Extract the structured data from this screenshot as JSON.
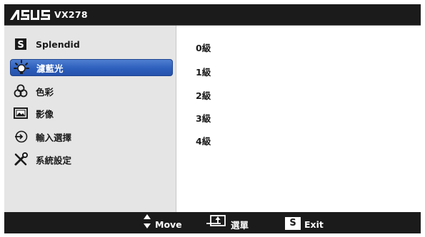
{
  "header": {
    "brand": "ASUS",
    "model": "VX278"
  },
  "sidebar": {
    "items": [
      {
        "label": "Splendid",
        "icon": "splendid-s-icon",
        "selected": false
      },
      {
        "label": "濾藍光",
        "icon": "bulb-rays-icon",
        "selected": true
      },
      {
        "label": "色彩",
        "icon": "color-circles-icon",
        "selected": false
      },
      {
        "label": "影像",
        "icon": "image-frame-icon",
        "selected": false
      },
      {
        "label": "輸入選擇",
        "icon": "input-arrow-icon",
        "selected": false
      },
      {
        "label": "系統設定",
        "icon": "tools-icon",
        "selected": false
      }
    ]
  },
  "main": {
    "options": [
      "0級",
      "1級",
      "2級",
      "3級",
      "4級"
    ]
  },
  "footer": {
    "move_label": "Move",
    "menu_label": "選單",
    "exit_label": "Exit",
    "exit_key": "S"
  },
  "colors": {
    "bar_background": "#1b1b1b",
    "sidebar_background": "#e5e5e5",
    "selection": "#2d5fbd"
  }
}
